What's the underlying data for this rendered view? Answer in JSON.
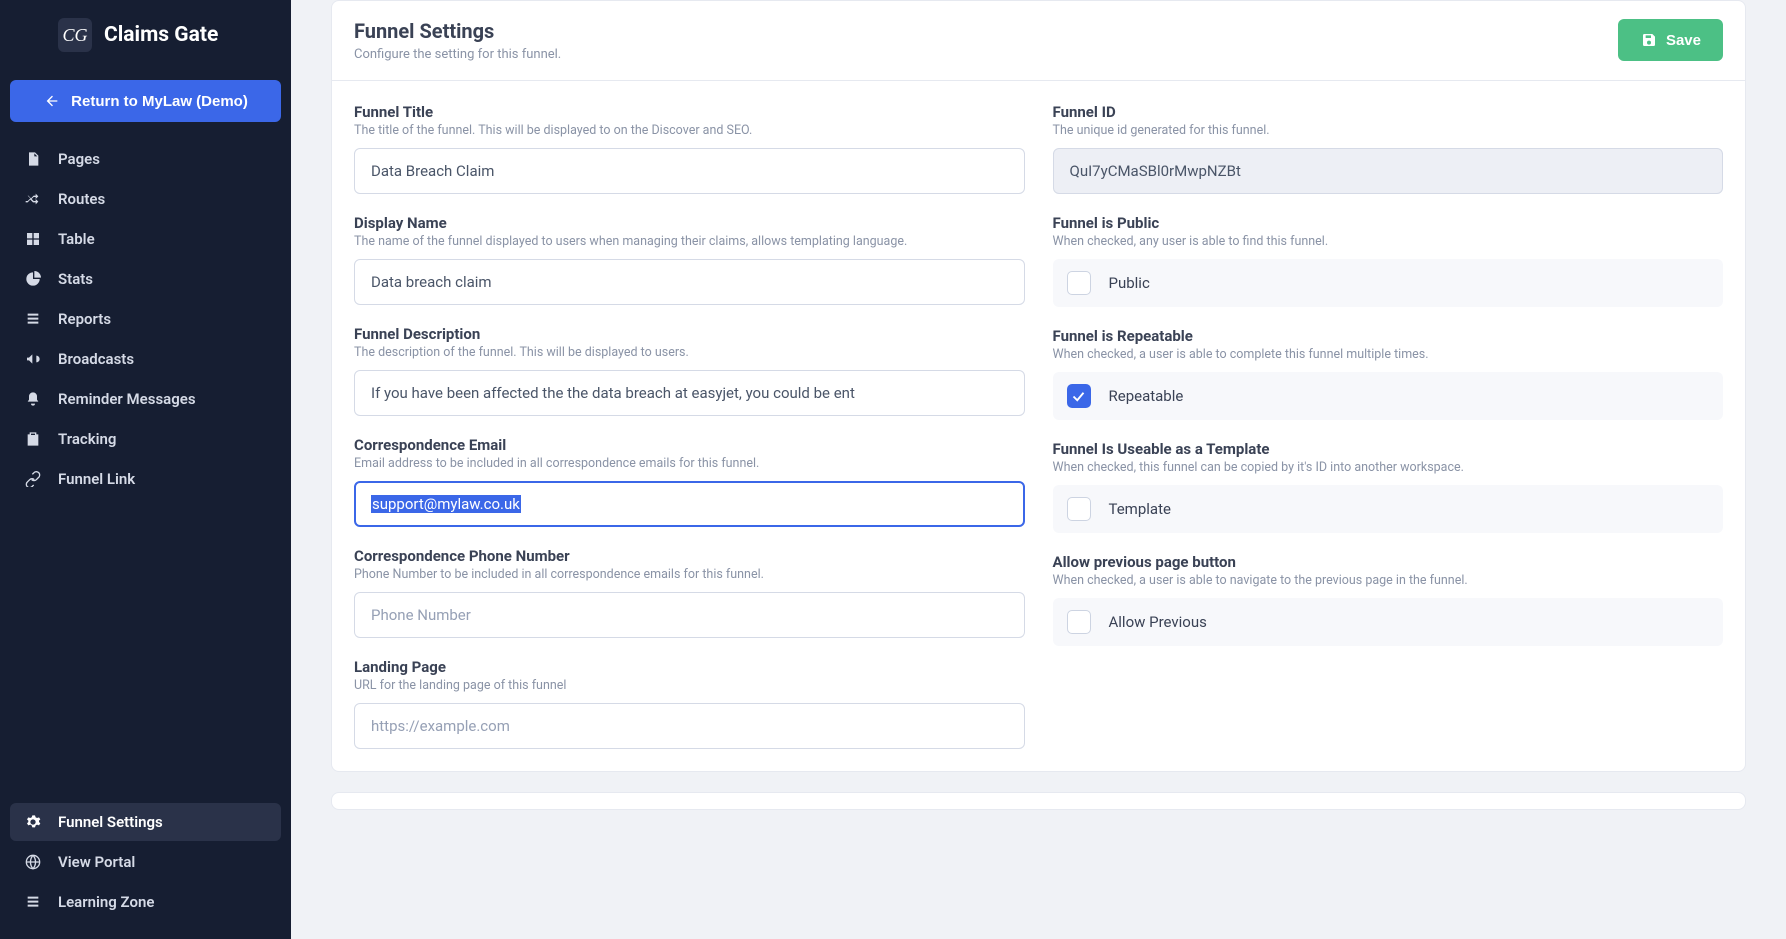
{
  "app": {
    "name": "Claims Gate",
    "logo_mark": "CG"
  },
  "sidebar": {
    "return_label": "Return to MyLaw (Demo)",
    "items": [
      {
        "label": "Pages",
        "icon": "file-icon"
      },
      {
        "label": "Routes",
        "icon": "shuffle-icon"
      },
      {
        "label": "Table",
        "icon": "grid-icon"
      },
      {
        "label": "Stats",
        "icon": "pie-icon"
      },
      {
        "label": "Reports",
        "icon": "list-icon"
      },
      {
        "label": "Broadcasts",
        "icon": "bullhorn-icon"
      },
      {
        "label": "Reminder Messages",
        "icon": "bell-icon"
      },
      {
        "label": "Tracking",
        "icon": "clipboard-icon"
      },
      {
        "label": "Funnel Link",
        "icon": "link-icon"
      }
    ],
    "bottom_items": [
      {
        "label": "Funnel Settings",
        "icon": "gear-icon",
        "active": true
      },
      {
        "label": "View Portal",
        "icon": "globe-icon"
      },
      {
        "label": "Learning Zone",
        "icon": "list-icon"
      }
    ]
  },
  "header": {
    "title": "Funnel Settings",
    "subtitle": "Configure the setting for this funnel.",
    "save_label": "Save"
  },
  "left": {
    "title": {
      "label": "Funnel Title",
      "help": "The title of the funnel. This will be displayed to on the Discover and SEO.",
      "value": "Data Breach Claim"
    },
    "display_name": {
      "label": "Display Name",
      "help": "The name of the funnel displayed to users when managing their claims, allows templating language.",
      "value": "Data breach claim"
    },
    "description": {
      "label": "Funnel Description",
      "help": "The description of the funnel. This will be displayed to users.",
      "value": "If you have been affected the the data breach at easyjet, you could be ent"
    },
    "email": {
      "label": "Correspondence Email",
      "help": "Email address to be included in all correspondence emails for this funnel.",
      "value": "support@mylaw.co.uk"
    },
    "phone": {
      "label": "Correspondence Phone Number",
      "help": "Phone Number to be included in all correspondence emails for this funnel.",
      "placeholder": "Phone Number"
    },
    "landing": {
      "label": "Landing Page",
      "help": "URL for the landing page of this funnel",
      "placeholder": "https://example.com"
    }
  },
  "right": {
    "id": {
      "label": "Funnel ID",
      "help": "The unique id generated for this funnel.",
      "value": "QuI7yCMaSBl0rMwpNZBt"
    },
    "public": {
      "label": "Funnel is Public",
      "help": "When checked, any user is able to find this funnel.",
      "option": "Public",
      "checked": false
    },
    "repeatable": {
      "label": "Funnel is Repeatable",
      "help": "When checked, a user is able to complete this funnel multiple times.",
      "option": "Repeatable",
      "checked": true
    },
    "template": {
      "label": "Funnel Is Useable as a Template",
      "help": "When checked, this funnel can be copied by it's ID into another workspace.",
      "option": "Template",
      "checked": false
    },
    "previous": {
      "label": "Allow previous page button",
      "help": "When checked, a user is able to navigate to the previous page in the funnel.",
      "option": "Allow Previous",
      "checked": false
    }
  }
}
